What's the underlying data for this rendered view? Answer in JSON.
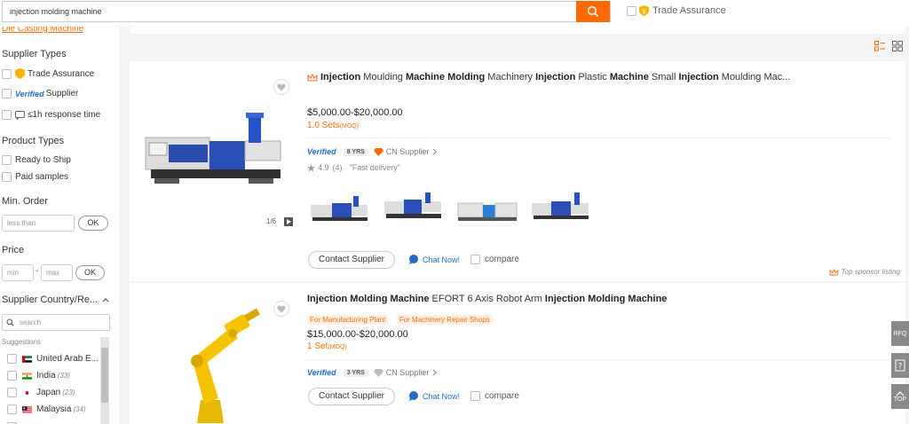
{
  "search": {
    "value": "injection molding machine"
  },
  "top_filter": {
    "trade_assurance": "Trade Assurance"
  },
  "sidebar": {
    "category_link": "Die Casting Machine",
    "supplier_types": {
      "heading": "Supplier Types",
      "trade_assurance": "Trade Assurance",
      "verified_logo": "Verified",
      "verified_label": "Supplier",
      "response": "≤1h response time"
    },
    "product_types": {
      "heading": "Product Types",
      "ready_to_ship": "Ready to Ship",
      "paid_samples": "Paid samples"
    },
    "min_order": {
      "heading": "Min. Order",
      "placeholder": "less than",
      "ok": "OK"
    },
    "price": {
      "heading": "Price",
      "min_placeholder": "min",
      "max_placeholder": "max",
      "ok": "OK",
      "dash": "-"
    },
    "country": {
      "heading": "Supplier Country/Re...",
      "search_placeholder": "search",
      "suggestions_label": "Suggestions",
      "items": [
        {
          "name": "United Arab E...",
          "count": ""
        },
        {
          "name": "India",
          "count": "(33)"
        },
        {
          "name": "Japan",
          "count": "(23)"
        },
        {
          "name": "Malaysia",
          "count": "(34)"
        }
      ]
    }
  },
  "products": [
    {
      "title_parts": [
        {
          "t": "Injection",
          "b": true
        },
        {
          "t": " Moulding ",
          "b": false
        },
        {
          "t": "Machine Molding",
          "b": true
        },
        {
          "t": " Machinery ",
          "b": false
        },
        {
          "t": "Injection",
          "b": true
        },
        {
          "t": " Plastic ",
          "b": false
        },
        {
          "t": "Machine",
          "b": true
        },
        {
          "t": " Small ",
          "b": false
        },
        {
          "t": "Injection",
          "b": true
        },
        {
          "t": " Moulding Mac...",
          "b": false
        }
      ],
      "price": "$5,000.00-$20,000.00",
      "moq_value": "1.0 Sets",
      "moq_unit": "(MOQ)",
      "verified": "Verified",
      "years": "8 YRS",
      "supplier": "CN Supplier",
      "rating": "4.9",
      "reviews": "(4)",
      "review_quote": "\"Fast delivery\"",
      "image_counter": "1/6",
      "contact": "Contact Supplier",
      "chat": "Chat Now!",
      "compare": "compare",
      "sponsor": "Top sponsor listing"
    },
    {
      "title_parts": [
        {
          "t": "Injection Molding Machine",
          "b": true
        },
        {
          "t": " EFORT 6 Axis Robot Arm ",
          "b": false
        },
        {
          "t": "Injection Molding Machine",
          "b": true
        }
      ],
      "tags": [
        "For Manufacturing Plant",
        "For Machinery Repair Shops"
      ],
      "price": "$15,000.00-$20,000.00",
      "moq_value": "1 Set",
      "moq_unit": "(MOQ)",
      "verified": "Verified",
      "years": "3 YRS",
      "supplier": "CN Supplier",
      "contact": "Contact Supplier",
      "chat": "Chat Now!",
      "compare": "compare"
    }
  ],
  "float_buttons": {
    "rfq": "RFQ",
    "top": "TOP"
  },
  "colors": {
    "accent": "#ff6a00",
    "verified_blue": "#1e6ec8"
  }
}
